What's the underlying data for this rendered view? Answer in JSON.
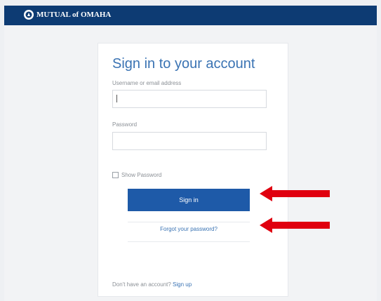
{
  "brand": {
    "name": "MUTUAL of OMAHA"
  },
  "form": {
    "title": "Sign in to your account",
    "username_label": "Username or email address",
    "username_value": "",
    "password_label": "Password",
    "password_value": "",
    "show_password_label": "Show Password",
    "signin_button": "Sign in",
    "forgot_link": "Forgot your password?",
    "no_account_text": "Don't have an account?",
    "signup_link": "Sign up"
  },
  "colors": {
    "header": "#0d3b73",
    "primary": "#1e5aa8",
    "accent_arrow": "#e0000f"
  }
}
